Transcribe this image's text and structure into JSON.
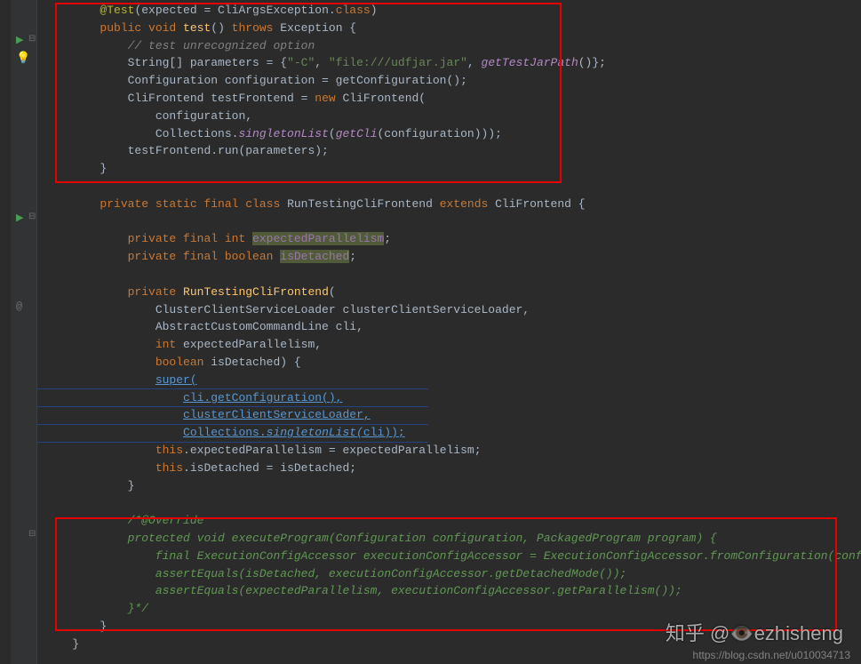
{
  "code": {
    "l1": "@Test",
    "l1b": "(expected = CliArgsException.",
    "l1c": "class",
    "l1d": ")",
    "l2a": "public void ",
    "l2b": "test",
    "l2c": "() ",
    "l2d": "throws ",
    "l2e": "Exception {",
    "l3": "// test unrecognized option",
    "l4a": "String[] parameters = {",
    "l4b": "\"-C\"",
    "l4c": ", ",
    "l4d": "\"file:///udfjar.jar\"",
    "l4e": ", ",
    "l4f": "getTestJarPath",
    "l4g": "()};",
    "l5a": "Configuration configuration = getConfiguration();",
    "l6a": "CliFrontend testFrontend = ",
    "l6b": "new ",
    "l6c": "CliFrontend(",
    "l7": "configuration,",
    "l8a": "Collections.",
    "l8b": "singletonList",
    "l8c": "(",
    "l8d": "getCli",
    "l8e": "(configuration)));",
    "l9": "testFrontend.run(parameters);",
    "l10": "}",
    "l12a": "private static final class ",
    "l12b": "RunTestingCliFrontend ",
    "l12c": "extends ",
    "l12d": "CliFrontend {",
    "l14a": "private final int ",
    "l14b": "expectedParallelism",
    "l14c": ";",
    "l15a": "private final boolean ",
    "l15b": "isDetached",
    "l15c": ";",
    "l17a": "private ",
    "l17b": "RunTestingCliFrontend",
    "l17c": "(",
    "l18": "ClusterClientServiceLoader clusterClientServiceLoader,",
    "l19": "AbstractCustomCommandLine cli,",
    "l20a": "int ",
    "l20b": "expectedParallelism,",
    "l21a": "boolean ",
    "l21b": "isDetached) {",
    "l22": "super(",
    "l23": "cli.getConfiguration(),",
    "l24": "clusterClientServiceLoader,",
    "l25a": "Collections.",
    "l25b": "singletonList(",
    "l25c": "cli));",
    "l26a": "this",
    "l26b": ".expectedParallelism = expectedParallelism;",
    "l27a": "this",
    "l27b": ".isDetached = isDetached;",
    "l28": "}",
    "l30": "/*@Override",
    "l31": "protected void executeProgram(Configuration configuration, PackagedProgram program) {",
    "l32": "    final ExecutionConfigAccessor executionConfigAccessor = ExecutionConfigAccessor.fromConfiguration(configuration);",
    "l33": "    assertEquals(isDetached, executionConfigAccessor.getDetachedMode());",
    "l34": "    assertEquals(expectedParallelism, executionConfigAccessor.getParallelism());",
    "l35": "}*/",
    "l36": "}",
    "l37": "}"
  },
  "watermark": {
    "main_prefix": "知乎 @",
    "main_suffix": "ezhisheng",
    "sub": "https://blog.csdn.net/u010034713"
  }
}
